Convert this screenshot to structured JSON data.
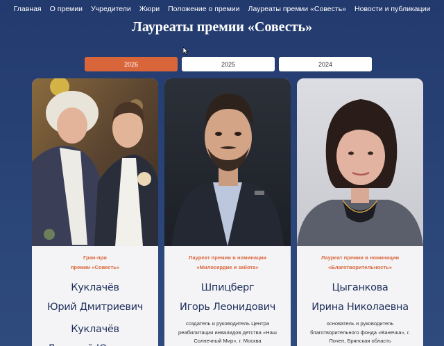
{
  "nav": {
    "items": [
      "Главная",
      "О премии",
      "Учредители",
      "Жюри",
      "Положение о премии",
      "Лауреаты премии «Совесть»",
      "Новости и публикации"
    ]
  },
  "page": {
    "title": "Лауреаты премии «Совесть»"
  },
  "years": {
    "tabs": [
      "2026",
      "2025",
      "2024"
    ],
    "active": "2026"
  },
  "laureates": [
    {
      "nomination": [
        "Гран-при",
        "премии «Совесть»"
      ],
      "names": [
        "Куклачёв",
        "Юрий Дмитриевич",
        "Куклачёв",
        "Дмитрий Юрьевич"
      ],
      "description": []
    },
    {
      "nomination": [
        "Лауреат премии в номинации",
        "«Милосердие и забота»"
      ],
      "names": [
        "Шпицберг",
        "Игорь Леонидович"
      ],
      "description": [
        "создатель и руководитель Центра",
        "реабилитации инвалидов детства «Наш",
        "Солнечный Мир», г. Москва"
      ]
    },
    {
      "nomination": [
        "Лауреат премии в номинации",
        "«Благотворительность»"
      ],
      "names": [
        "Цыганкова",
        "Ирина Николаевна"
      ],
      "description": [
        "основатель и руководитель",
        "благотворительного фонда «Ванечка», г.",
        "Почеп, Брянская область"
      ]
    }
  ],
  "colors": {
    "accent": "#d9653a",
    "background": "#233a6e",
    "name_text": "#1f2f5c"
  }
}
